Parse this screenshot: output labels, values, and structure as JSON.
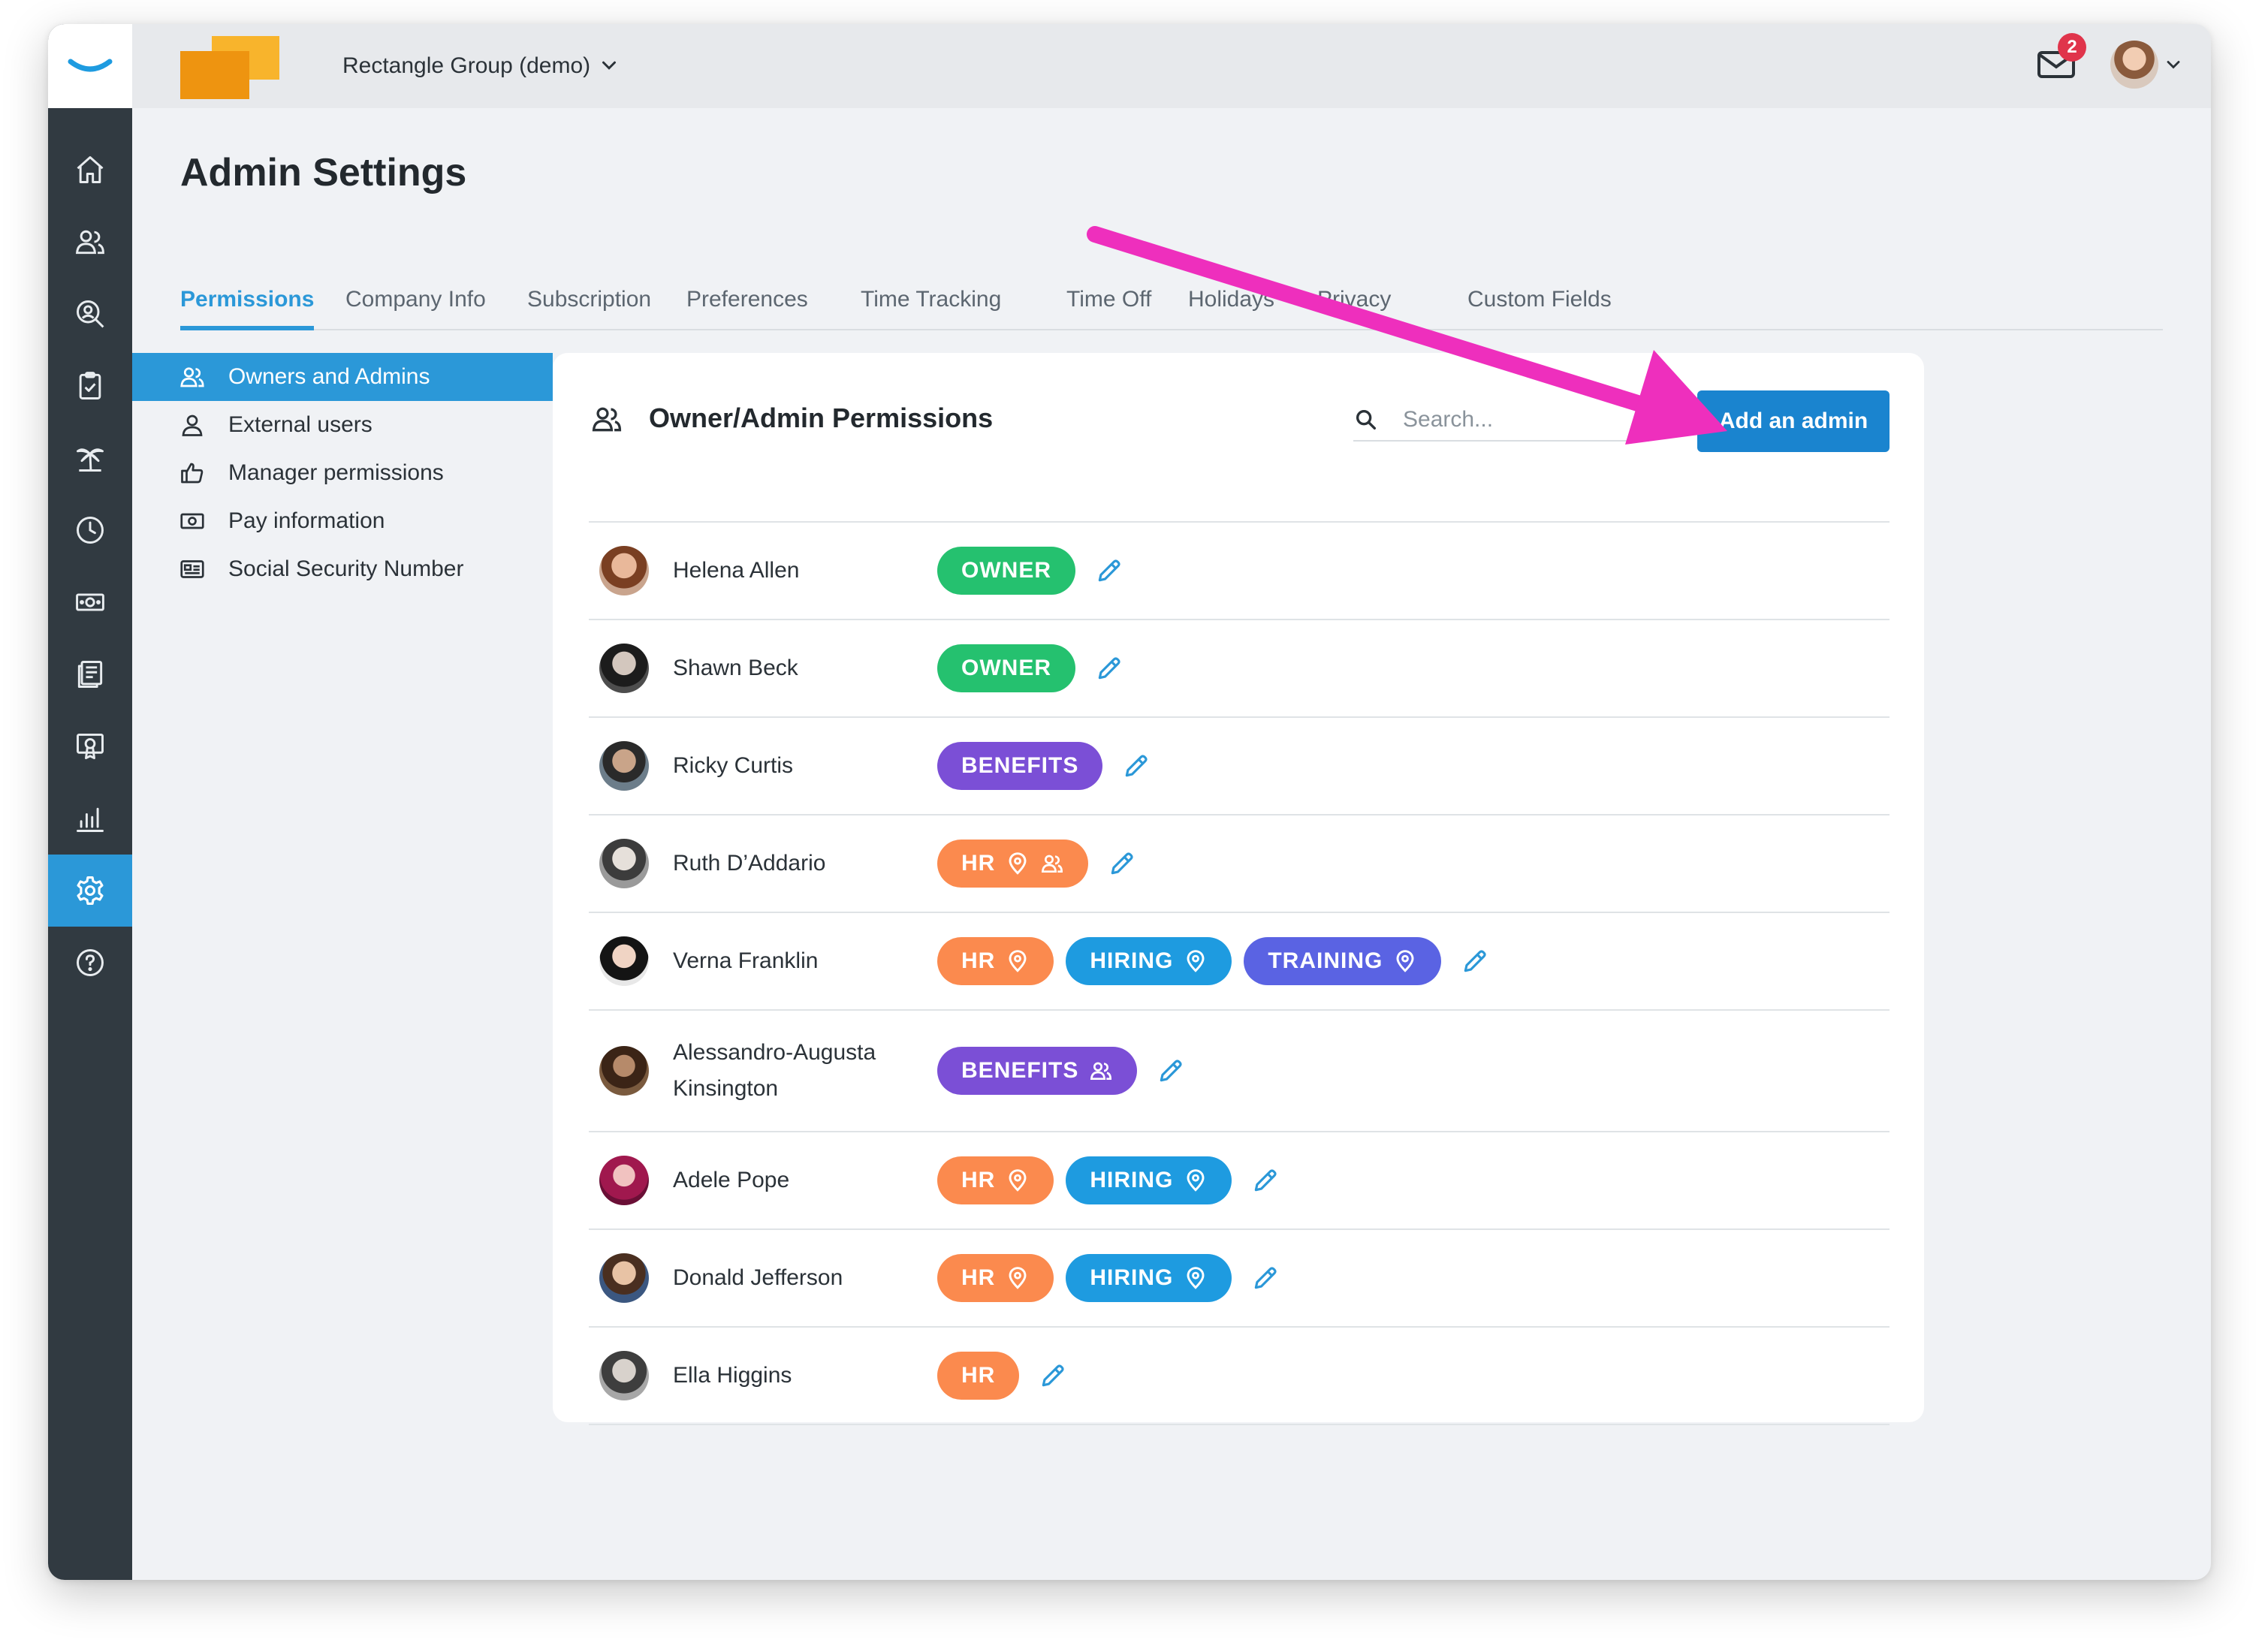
{
  "topbar": {
    "company_name": "Rectangle Group (demo)",
    "mail_badge": "2"
  },
  "page": {
    "title": "Admin Settings"
  },
  "tabs": [
    {
      "label": "Permissions",
      "active": true
    },
    {
      "label": "Company Info"
    },
    {
      "label": "Subscription"
    },
    {
      "label": "Preferences"
    },
    {
      "label": "Time Tracking"
    },
    {
      "label": "Time Off"
    },
    {
      "label": "Holidays"
    },
    {
      "label": "Privacy"
    },
    {
      "label": "Custom Fields"
    }
  ],
  "submenu": [
    {
      "label": "Owners and Admins",
      "icon": "users-icon",
      "active": true
    },
    {
      "label": "External users",
      "icon": "user-icon"
    },
    {
      "label": "Manager permissions",
      "icon": "thumbs-up-icon"
    },
    {
      "label": "Pay information",
      "icon": "money-icon"
    },
    {
      "label": "Social Security Number",
      "icon": "id-card-icon"
    }
  ],
  "card": {
    "title": "Owner/Admin Permissions",
    "search_placeholder": "Search...",
    "add_button": "Add an admin"
  },
  "admins": [
    {
      "name": "Helena Allen",
      "roles": [
        {
          "label": "OWNER",
          "color": "#25c16f",
          "icons": []
        }
      ]
    },
    {
      "name": "Shawn Beck",
      "roles": [
        {
          "label": "OWNER",
          "color": "#25c16f",
          "icons": []
        }
      ]
    },
    {
      "name": "Ricky Curtis",
      "roles": [
        {
          "label": "BENEFITS",
          "color": "#7b4fd6",
          "icons": []
        }
      ]
    },
    {
      "name": "Ruth D’Addario",
      "roles": [
        {
          "label": "HR",
          "color": "#fb8a4e",
          "icons": [
            "location-pin-icon",
            "users-icon"
          ]
        }
      ]
    },
    {
      "name": "Verna Franklin",
      "roles": [
        {
          "label": "HR",
          "color": "#fb8a4e",
          "icons": [
            "location-pin-icon"
          ]
        },
        {
          "label": "HIRING",
          "color": "#1e9be0",
          "icons": [
            "location-pin-icon"
          ]
        },
        {
          "label": "TRAINING",
          "color": "#5a63e3",
          "icons": [
            "location-pin-icon"
          ]
        }
      ]
    },
    {
      "name": "Alessandro-Augusta\nKinsington",
      "roles": [
        {
          "label": "BENEFITS",
          "color": "#7b4fd6",
          "icons": [
            "users-icon"
          ]
        }
      ]
    },
    {
      "name": "Adele Pope",
      "roles": [
        {
          "label": "HR",
          "color": "#fb8a4e",
          "icons": [
            "location-pin-icon"
          ]
        },
        {
          "label": "HIRING",
          "color": "#1e9be0",
          "icons": [
            "location-pin-icon"
          ]
        }
      ]
    },
    {
      "name": "Donald Jefferson",
      "roles": [
        {
          "label": "HR",
          "color": "#fb8a4e",
          "icons": [
            "location-pin-icon"
          ]
        },
        {
          "label": "HIRING",
          "color": "#1e9be0",
          "icons": [
            "location-pin-icon"
          ]
        }
      ]
    },
    {
      "name": "Ella Higgins",
      "roles": [
        {
          "label": "HR",
          "color": "#fb8a4e",
          "icons": []
        }
      ]
    }
  ],
  "colors": {
    "accent": "#2b98d8",
    "button": "#1a84cf",
    "sidebar": "#313a41",
    "annotation_arrow": "#ee2fbd"
  }
}
